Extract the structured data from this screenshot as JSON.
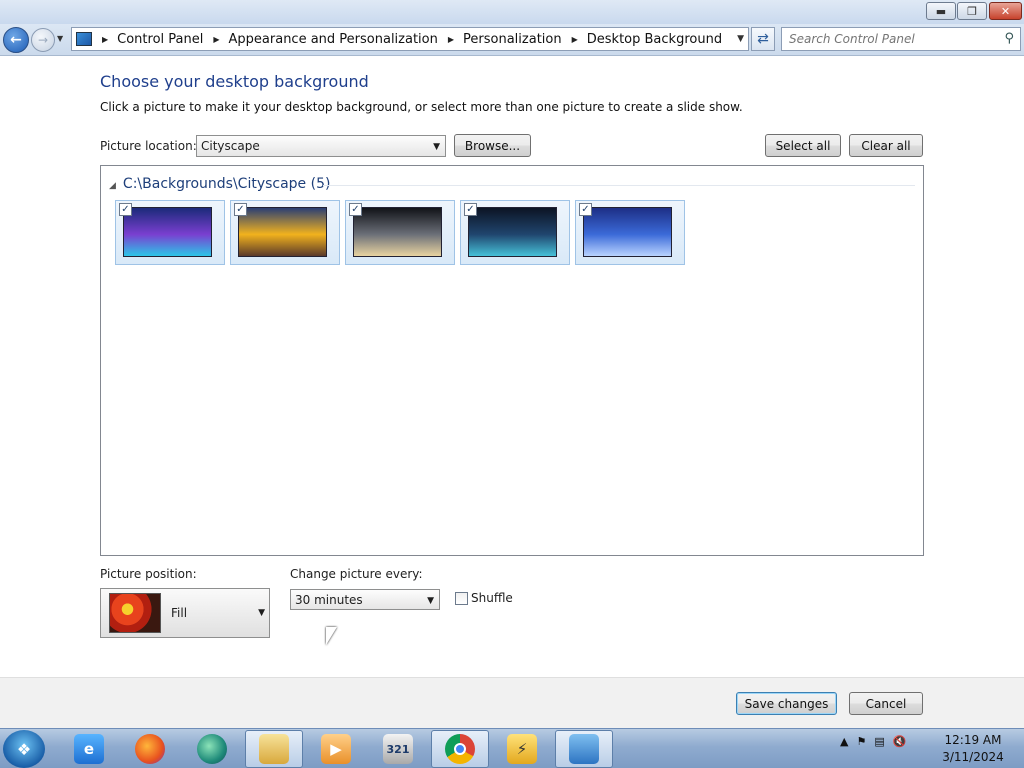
{
  "window": {
    "minimize_icon": "minimize-icon",
    "maximize_icon": "restore-icon",
    "close_icon": "close-icon"
  },
  "nav": {
    "breadcrumbs": [
      "Control Panel",
      "Appearance and Personalization",
      "Personalization",
      "Desktop Background"
    ],
    "search_placeholder": "Search Control Panel"
  },
  "main": {
    "heading": "Choose your desktop background",
    "subtext": "Click a picture to make it your desktop background, or select more than one picture to create a slide show.",
    "picture_location_label": "Picture location:",
    "picture_location_value": "Cityscape",
    "browse_label": "Browse...",
    "select_all_label": "Select all",
    "clear_all_label": "Clear all",
    "group_header": "C:\\Backgrounds\\Cityscape (5)",
    "thumbnails": [
      {
        "checked": true,
        "colors": [
          "#1b2a7a",
          "#7a3fd0",
          "#2cc6e8"
        ]
      },
      {
        "checked": true,
        "colors": [
          "#2b3f73",
          "#f2b21d",
          "#5a3a2a"
        ]
      },
      {
        "checked": true,
        "colors": [
          "#111318",
          "#6b6f78",
          "#e8d3a0"
        ]
      },
      {
        "checked": true,
        "colors": [
          "#0c1424",
          "#20456e",
          "#46c1d8"
        ]
      },
      {
        "checked": true,
        "colors": [
          "#1d2f86",
          "#3b6ad8",
          "#b9d3ff"
        ]
      }
    ],
    "picture_position_label": "Picture position:",
    "picture_position_value": "Fill",
    "change_picture_label": "Change picture every:",
    "change_picture_value": "30 minutes",
    "shuffle_label": "Shuffle",
    "shuffle_checked": false
  },
  "footer": {
    "save_label": "Save changes",
    "cancel_label": "Cancel"
  },
  "taskbar": {
    "items": [
      "internet-explorer",
      "firefox",
      "unknown-app",
      "file-explorer",
      "media-player",
      "media-player-classic",
      "chrome",
      "app",
      "control-panel"
    ],
    "clock_time": "12:19 AM",
    "clock_date": "3/11/2024"
  }
}
